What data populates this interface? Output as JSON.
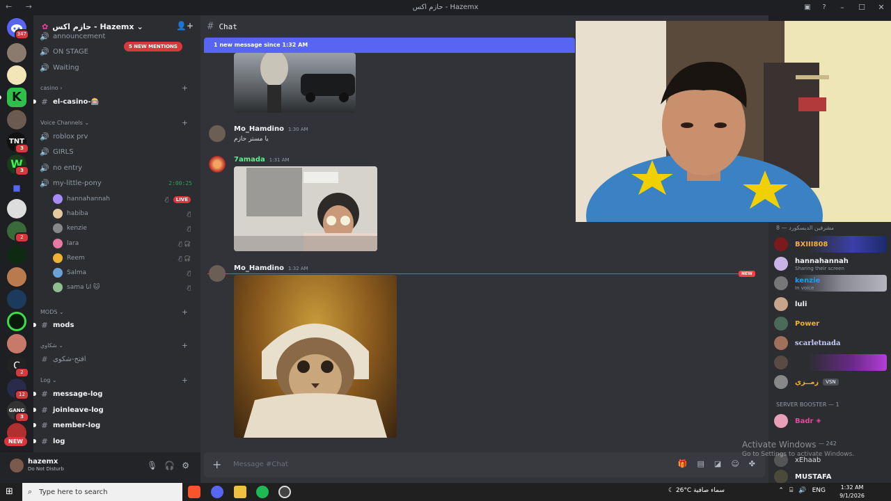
{
  "window": {
    "title": "حازم اكس - Hazemx"
  },
  "server": {
    "name": "حازم اكس - Hazemx"
  },
  "guild_badges": {
    "dm_count": "347",
    "g1": "3",
    "g2": "3",
    "g3": "2",
    "g4": "2",
    "g5": "12",
    "g6": "3"
  },
  "new_pill": "NEW",
  "mentions_pill": "5 NEW MENTIONS",
  "channels": {
    "top": [
      {
        "name": "announcement"
      },
      {
        "name": "ON STAGE"
      },
      {
        "name": "Waiting"
      }
    ],
    "casino_cat": "casino",
    "casino_channel": "el-casino-🎰",
    "voice_cat": "Voice Channels",
    "voice": [
      "roblox prv",
      "GIRLS",
      "no entry",
      "my-little-pony"
    ],
    "voice_timer": "2:00:25",
    "voice_users": [
      "hannahannah",
      "habiba",
      "kenzie",
      "lara",
      "Reem",
      "Salma",
      "sama"
    ],
    "sama_suffix": "انا 🐱",
    "live_label": "LIVE",
    "mods_cat": "MODS",
    "mods_channel": "mods",
    "complaints_cat": "شكاوي",
    "complaints_channel": "افتح-شكوى",
    "log_cat": "Log",
    "log_channels": [
      "message-log",
      "joinleave-log",
      "member-log",
      "log"
    ]
  },
  "user": {
    "name": "hazemx",
    "status": "Do Not Disturb"
  },
  "chat": {
    "channel": "Chat",
    "new_banner": "1 new message since 1:32 AM",
    "messages": [
      {
        "author": "Mo_Hamdino",
        "time": "1:30 AM",
        "text": "يا مستر حازم"
      },
      {
        "author": "7amada",
        "time": "1:31 AM"
      },
      {
        "author": "Mo_Hamdino",
        "time": "1:32 AM"
      }
    ],
    "new_tag": "NEW",
    "placeholder": "Message #Chat"
  },
  "members": {
    "group1": "مشرفين الديسكورد — 8",
    "list": [
      {
        "name": "BXIII808",
        "color": "#f0b232"
      },
      {
        "name": "hannahannah",
        "sub": "Sharing their screen",
        "color": "#f2f3f5"
      },
      {
        "name": "kenzie",
        "sub": "In voice",
        "color": "#00a8fc"
      },
      {
        "name": "luli",
        "color": "#f2f3f5"
      },
      {
        "name": "Power",
        "color": "#f0b232"
      },
      {
        "name": "scarletnada",
        "color": "#c9cdfb"
      },
      {
        "name": "",
        "color": "#eb459e"
      },
      {
        "name": "زمــزي",
        "tag": "VSN",
        "color": "#f0b232"
      }
    ],
    "group2": "SERVER BOOSTER — 1",
    "booster": "Badr",
    "group3": "— 242",
    "extra": [
      "xEhaab",
      "MUSTAFA"
    ]
  },
  "windows_watermark": {
    "line1": "Activate Windows",
    "line2": "Go to Settings to activate Windows."
  },
  "taskbar": {
    "search": "Type here to search",
    "weather": "26°C  سماء صافية",
    "lang": "ENG",
    "time": "1:32 AM",
    "date": "9/1/2026"
  }
}
